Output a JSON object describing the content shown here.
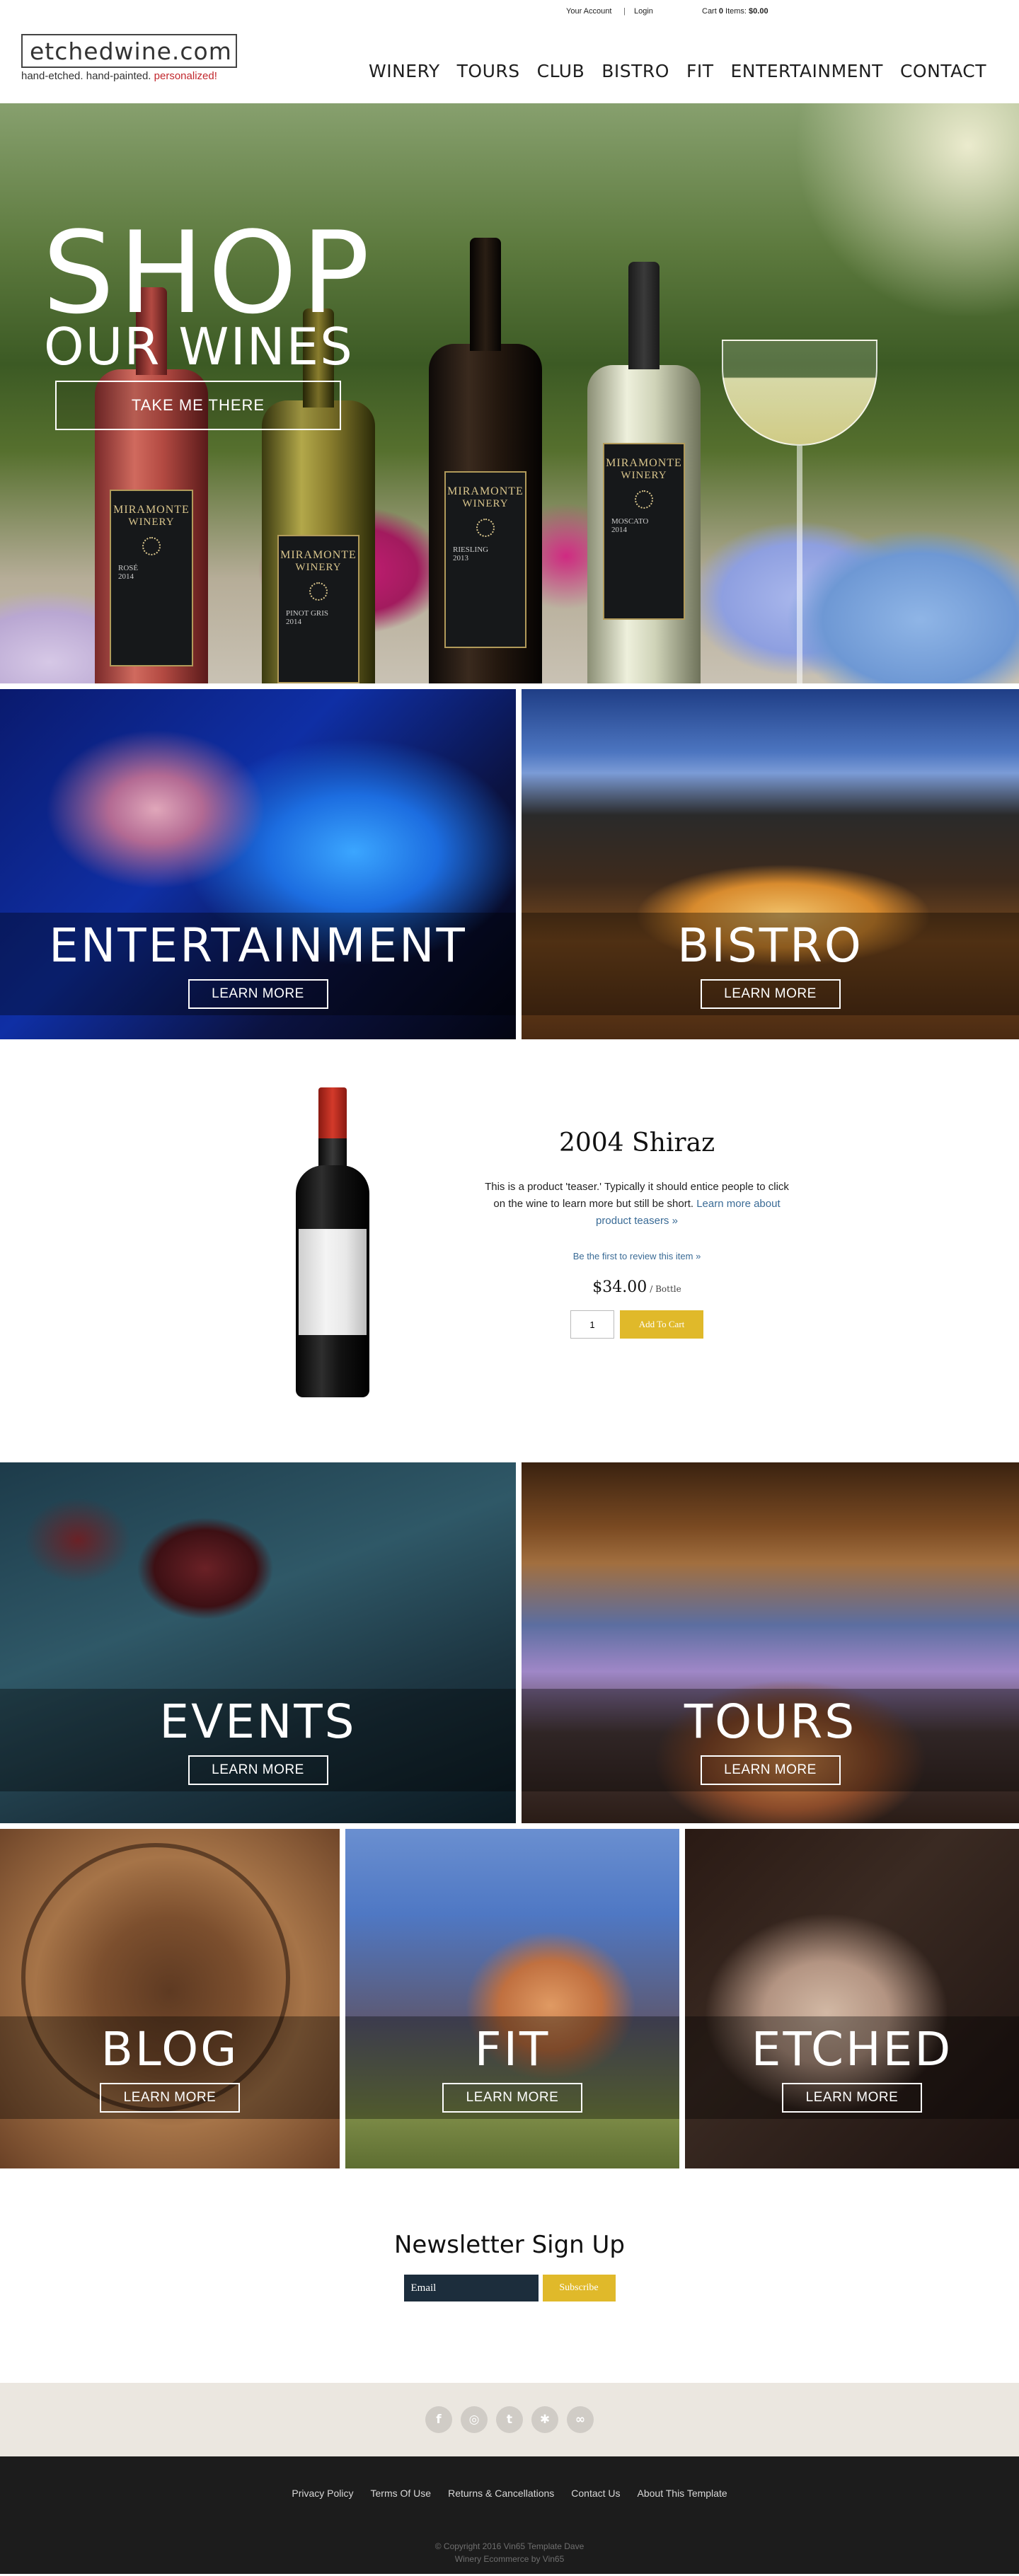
{
  "util": {
    "account": "Your Account",
    "separator": "|",
    "login": "Login",
    "cart_prefix": "Cart",
    "cart_count": "0",
    "cart_items_label": "Items:",
    "cart_total": "$0.00"
  },
  "logo": {
    "name": "etchedwine.com",
    "tagline": "hand-etched.  hand-painted.",
    "tagline_accent": "personalized!"
  },
  "nav": [
    "WINERY",
    "TOURS",
    "CLUB",
    "BISTRO",
    "FIT",
    "ENTERTAINMENT",
    "CONTACT"
  ],
  "hero": {
    "title_line1": "SHOP",
    "title_line2": "OUR WINES",
    "cta": "TAKE ME THERE",
    "bottles": [
      {
        "winery_line1": "MIRAMONTE",
        "winery_line2": "WINERY",
        "varietal": "ROSÉ",
        "vintage": "2014"
      },
      {
        "winery_line1": "MIRAMONTE",
        "winery_line2": "WINERY",
        "varietal": "PINOT GRIS",
        "vintage": "2014"
      },
      {
        "winery_line1": "MIRAMONTE",
        "winery_line2": "WINERY",
        "varietal": "RIESLING",
        "vintage": "2013"
      },
      {
        "winery_line1": "MIRAMONTE",
        "winery_line2": "WINERY",
        "varietal": "MOSCATO",
        "vintage": "2014"
      }
    ]
  },
  "tiles_row1": [
    {
      "title": "ENTERTAINMENT",
      "button": "LEARN MORE"
    },
    {
      "title": "BISTRO",
      "button": "LEARN MORE"
    }
  ],
  "product": {
    "name": "2004 Shiraz",
    "description": "This is a product 'teaser.' Typically it should entice people to click on the wine to learn more but still be short.",
    "learn_more": "Learn more about product teasers »",
    "review_link": "Be the first to review this item »",
    "price": "$34.00",
    "unit": "/ Bottle",
    "quantity": "1",
    "add_to_cart": "Add To Cart"
  },
  "tiles_row2": [
    {
      "title": "EVENTS",
      "button": "LEARN MORE"
    },
    {
      "title": "TOURS",
      "button": "LEARN MORE"
    }
  ],
  "tiles_row3": [
    {
      "title": "BLOG",
      "button": "LEARN MORE"
    },
    {
      "title": "FIT",
      "button": "LEARN MORE"
    },
    {
      "title": "ETCHED",
      "button": "LEARN MORE"
    }
  ],
  "newsletter": {
    "heading": "Newsletter Sign Up",
    "placeholder": "Email",
    "button": "Subscribe"
  },
  "social": [
    {
      "icon": "facebook-icon",
      "glyph": "f"
    },
    {
      "icon": "instagram-icon",
      "glyph": "◎"
    },
    {
      "icon": "twitter-icon",
      "glyph": "t"
    },
    {
      "icon": "yelp-icon",
      "glyph": "✱"
    },
    {
      "icon": "tripadvisor-icon",
      "glyph": "∞"
    }
  ],
  "footer": {
    "links": [
      "Privacy Policy",
      "Terms Of Use",
      "Returns & Cancellations",
      "Contact Us",
      "About This Template"
    ],
    "copyright": "© Copyright 2016 Vin65 Template Dave",
    "credit": "Winery Ecommerce by Vin65"
  },
  "colors": {
    "accent_gold": "#e0b92a",
    "link_blue": "#3a6b96",
    "footer_bg": "#1c1c1c",
    "social_bg": "#ebe7e0",
    "tagline_red": "#c1272d"
  }
}
